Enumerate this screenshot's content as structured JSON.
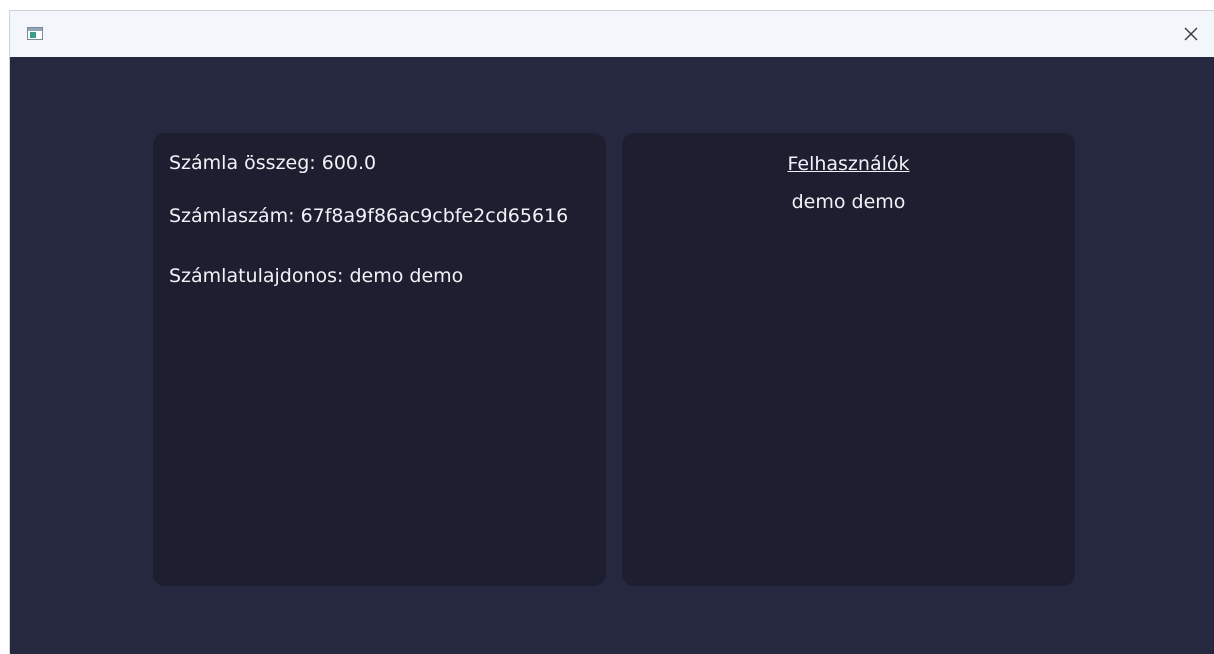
{
  "window": {
    "icon": "app-window-icon",
    "close_icon": "close-icon"
  },
  "account_card": {
    "amount": "Számla összeg: 600.0",
    "number": "Számlaszám: 67f8a9f86ac9cbfe2cd65616",
    "owner": "Számlatulajdonos: demo demo"
  },
  "users_card": {
    "title": "Felhasználók",
    "users": [
      "demo demo"
    ]
  },
  "colors": {
    "background": "#262840",
    "card": "#1e1e31",
    "text": "#f2f2f6",
    "titlebar": "#f3f6fb"
  }
}
